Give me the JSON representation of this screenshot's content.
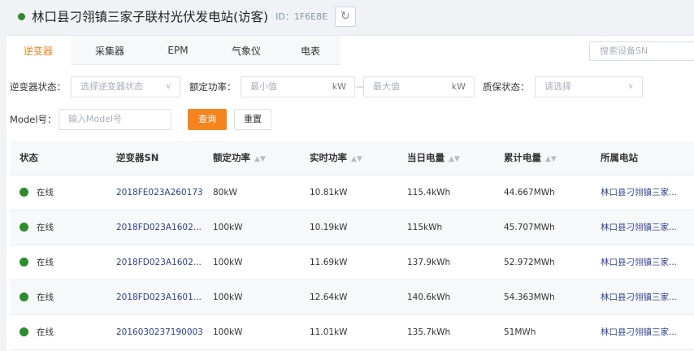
{
  "colors": {
    "accent": "#f5841f",
    "online": "#2e8b2e",
    "link": "#2d3f8f"
  },
  "header": {
    "title": "林口县刁翎镇三家子联村光伏发电站(访客)",
    "id_text": "ID：1F6E8E",
    "refresh_icon": "refresh-icon"
  },
  "tabs": [
    {
      "label": "逆变器",
      "active": true
    },
    {
      "label": "采集器",
      "active": false
    },
    {
      "label": "EPM",
      "active": false
    },
    {
      "label": "气象仪",
      "active": false
    },
    {
      "label": "电表",
      "active": false
    }
  ],
  "search_sn": {
    "placeholder": "搜索设备SN"
  },
  "filters": {
    "inverter_status_label": "逆变器状态：",
    "inverter_status_placeholder": "选择逆变器状态",
    "rated_power_label": "额定功率：",
    "min_placeholder": "最小值",
    "max_placeholder": "最大值",
    "unit": "kW",
    "dash": "—",
    "warranty_label": "质保状态：",
    "warranty_placeholder": "请选择",
    "model_label": "Model号：",
    "model_placeholder": "输入Model号",
    "query_label": "查询",
    "reset_label": "重置"
  },
  "table": {
    "columns": [
      "状态",
      "逆变器SN",
      "额定功率",
      "实时功率",
      "当日电量",
      "累计电量",
      "所属电站"
    ],
    "rows": [
      {
        "status": "在线",
        "sn": "2018FE023A260173",
        "rated": "80kW",
        "realtime": "10.81kW",
        "daily": "115.4kWh",
        "total": "44.667MWh",
        "station": "林口县刁翎镇三家..."
      },
      {
        "status": "在线",
        "sn": "2018FD023A1602...",
        "rated": "100kW",
        "realtime": "10.19kW",
        "daily": "115kWh",
        "total": "45.707MWh",
        "station": "林口县刁翎镇三家..."
      },
      {
        "status": "在线",
        "sn": "2018FD023A1602...",
        "rated": "100kW",
        "realtime": "11.69kW",
        "daily": "137.9kWh",
        "total": "52.972MWh",
        "station": "林口县刁翎镇三家..."
      },
      {
        "status": "在线",
        "sn": "2018FD023A1601...",
        "rated": "100kW",
        "realtime": "12.64kW",
        "daily": "140.6kWh",
        "total": "54.363MWh",
        "station": "林口县刁翎镇三家..."
      },
      {
        "status": "在线",
        "sn": "2016030237190003",
        "rated": "100kW",
        "realtime": "11.01kW",
        "daily": "135.7kWh",
        "total": "51MWh",
        "station": "林口县刁翎镇三家..."
      }
    ]
  }
}
